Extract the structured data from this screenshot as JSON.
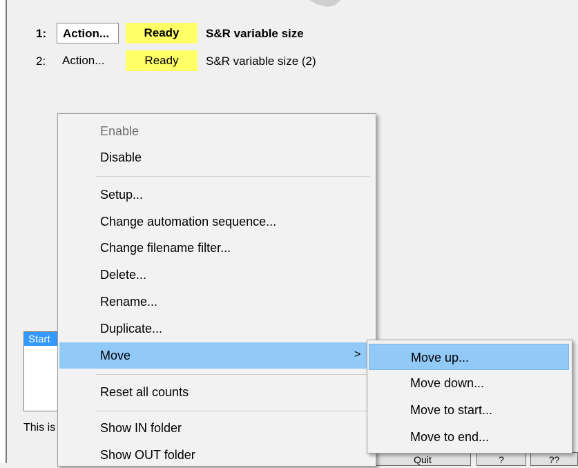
{
  "sequences": [
    {
      "index": "1:",
      "action": "Action...",
      "status": "Ready",
      "name": "S&R variable size"
    },
    {
      "index": "2:",
      "action": "Action...",
      "status": "Ready",
      "name": "S&R variable size (2)"
    }
  ],
  "log_panel": {
    "header": "Start"
  },
  "footer": {
    "text": "This is"
  },
  "buttons": {
    "quit": "Quit",
    "help1": "?",
    "help2": "??"
  },
  "context_menu": {
    "items": [
      {
        "label": "Enable",
        "disabled": true
      },
      {
        "label": "Disable"
      },
      {
        "label": "Setup..."
      },
      {
        "label": "Change automation sequence..."
      },
      {
        "label": "Change filename filter..."
      },
      {
        "label": "Delete..."
      },
      {
        "label": "Rename..."
      },
      {
        "label": "Duplicate..."
      },
      {
        "label": "Move",
        "highlighted": true,
        "submenu_arrow": ">"
      },
      {
        "label": "Reset all counts"
      },
      {
        "label": "Show IN folder"
      },
      {
        "label": "Show OUT folder"
      }
    ]
  },
  "submenu": {
    "items": [
      {
        "label": "Move up...",
        "highlighted": true
      },
      {
        "label": "Move down..."
      },
      {
        "label": "Move to start..."
      },
      {
        "label": "Move to end..."
      }
    ]
  },
  "colors": {
    "status_ready": "#ffff66",
    "menu_highlight": "#91c9f7",
    "selection_blue": "#3399ff"
  }
}
